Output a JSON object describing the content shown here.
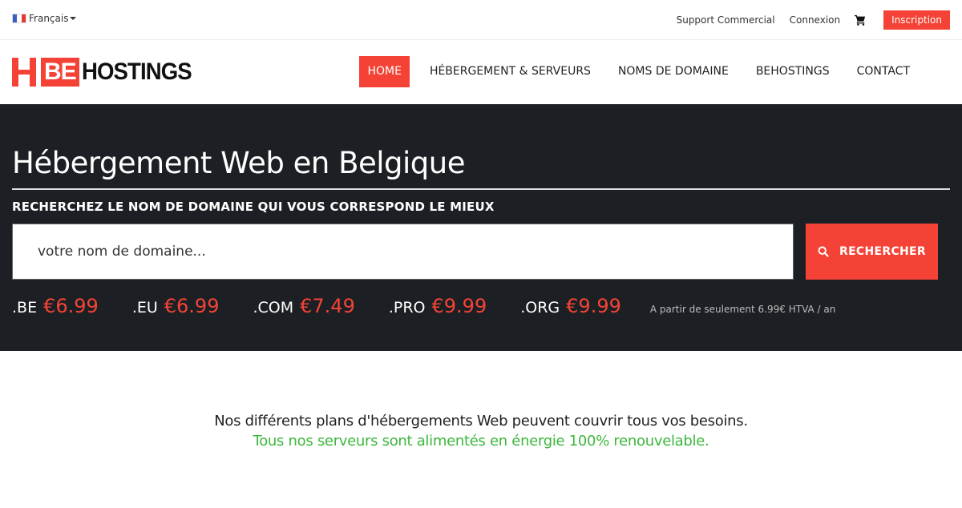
{
  "topbar": {
    "language": "Français",
    "links": [
      "Support Commercial",
      "Connexion"
    ],
    "cart_icon": "shopping-cart-icon",
    "signup_label": "Inscription"
  },
  "brand": {
    "logo_mark": "H",
    "logo_be": "BE",
    "logo_text": "HOSTINGS",
    "accent_color": "#f44336"
  },
  "nav": {
    "items": [
      {
        "label": "HOME",
        "active": true
      },
      {
        "label": "HÉBERGEMENT & SERVEURS",
        "active": false
      },
      {
        "label": "NOMS DE DOMAINE",
        "active": false
      },
      {
        "label": "BEHOSTINGS",
        "active": false
      },
      {
        "label": "CONTACT",
        "active": false
      }
    ]
  },
  "hero": {
    "title": "Hébergement Web en Belgique",
    "subtitle": "RECHERCHEZ LE NOM DE DOMAINE QUI VOUS CORRESPOND LE MIEUX",
    "search_placeholder": "votre nom de domaine...",
    "search_value": "",
    "search_button": "RECHERCHER",
    "prices": [
      {
        "tld": ".BE",
        "price": "€6.99"
      },
      {
        "tld": ".EU",
        "price": "€6.99"
      },
      {
        "tld": ".COM",
        "price": "€7.49"
      },
      {
        "tld": ".PRO",
        "price": "€9.99"
      },
      {
        "tld": ".ORG",
        "price": "€9.99"
      }
    ],
    "price_note": "A partir de seulement 6.99€ HTVA / an"
  },
  "intro": {
    "line1": "Nos différents plans d'hébergements Web peuvent couvrir tous vos besoins.",
    "line2": "Tous nos serveurs sont alimentés en énergie 100% renouvelable.",
    "line2_color": "#3cb83c"
  }
}
